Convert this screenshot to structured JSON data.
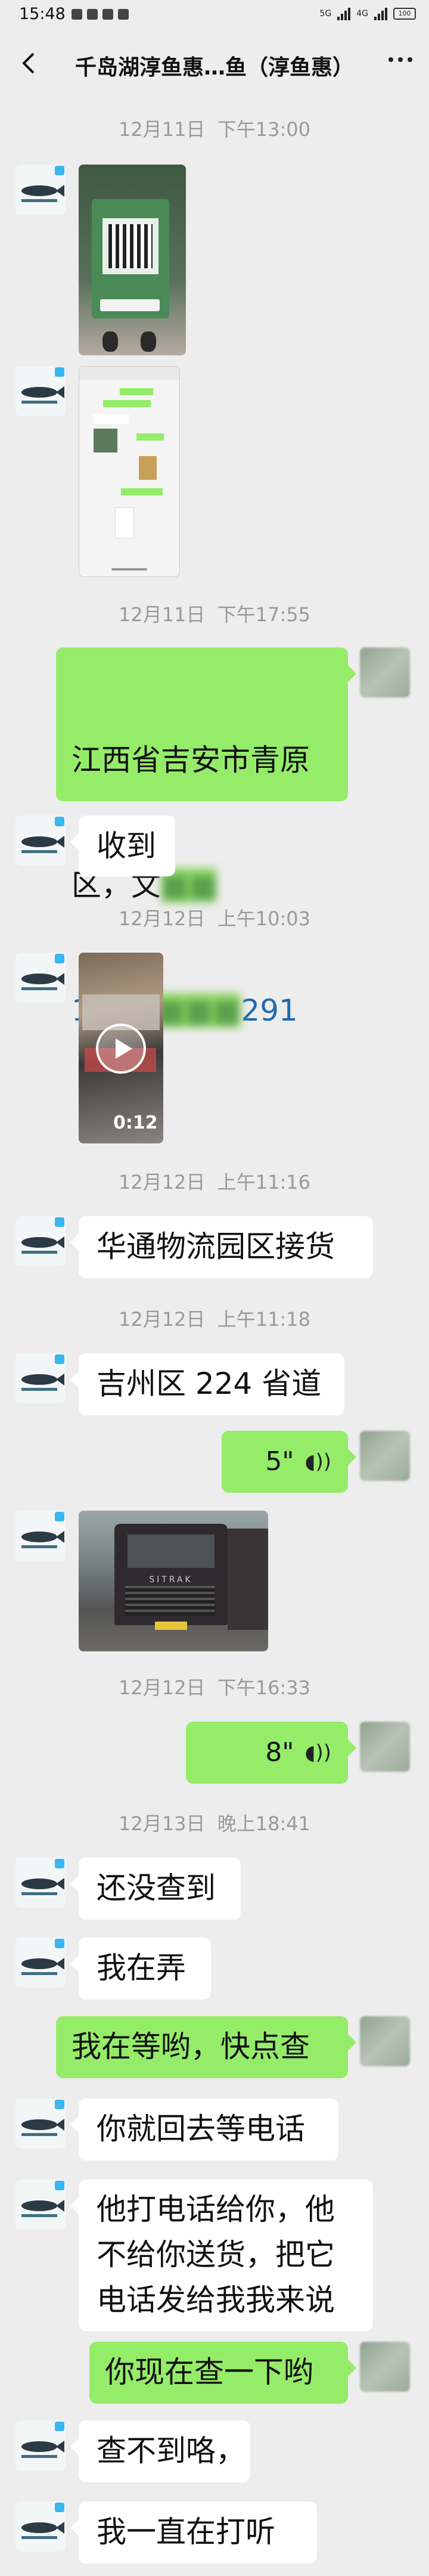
{
  "status_bar": {
    "time": "15:48",
    "network": "5G",
    "signal2": "4G",
    "battery": "100"
  },
  "header": {
    "title": "千岛湖淳鱼惠…鱼（淳鱼惠）"
  },
  "messages": [
    {
      "type": "time",
      "text": "12月11日  下午13:00"
    },
    {
      "type": "image",
      "side": "left",
      "desc": "二维码支付照片"
    },
    {
      "type": "image",
      "side": "left",
      "desc": "聊天截图"
    },
    {
      "type": "time",
      "text": "12月11日  下午17:55"
    },
    {
      "type": "text",
      "side": "right",
      "line1": "江西省吉安市青原",
      "line2_a": "区，文",
      "line2_b": "■■",
      "line3_a": "139",
      "line3_b": "■■■■",
      "line3_c": "291"
    },
    {
      "type": "text",
      "side": "left",
      "text": "收到"
    },
    {
      "type": "time",
      "text": "12月12日  上午10:03"
    },
    {
      "type": "video",
      "side": "left",
      "duration": "0:12"
    },
    {
      "type": "time",
      "text": "12月12日  上午11:16"
    },
    {
      "type": "text",
      "side": "left",
      "text": "华通物流园区接货"
    },
    {
      "type": "time",
      "text": "12月12日  上午11:18"
    },
    {
      "type": "text",
      "side": "left",
      "text": "吉州区 224 省道"
    },
    {
      "type": "voice",
      "side": "right",
      "duration": "5\""
    },
    {
      "type": "image",
      "side": "left",
      "desc": "货车照片",
      "truck_brand": "SITRAK"
    },
    {
      "type": "time",
      "text": "12月12日  下午16:33"
    },
    {
      "type": "voice",
      "side": "right",
      "duration": "8\""
    },
    {
      "type": "time",
      "text": "12月13日  晚上18:41"
    },
    {
      "type": "text",
      "side": "left",
      "text": "还没查到"
    },
    {
      "type": "text",
      "side": "left",
      "text": "我在弄"
    },
    {
      "type": "text",
      "side": "right",
      "text": "我在等哟，快点查"
    },
    {
      "type": "text",
      "side": "left",
      "text": "你就回去等电话"
    },
    {
      "type": "text",
      "side": "left",
      "text": "他打电话给你，他\n不给你送货，把它\n电话发给我我来说"
    },
    {
      "type": "text",
      "side": "right",
      "text": "你现在查一下哟"
    },
    {
      "type": "text",
      "side": "left",
      "text": "查不到咯，"
    },
    {
      "type": "text",
      "side": "left",
      "text": "我一直在打听"
    }
  ],
  "colors": {
    "background": "#ededed",
    "self_bubble": "#95ec69",
    "other_bubble": "#ffffff",
    "timestamp": "#9a9a9a"
  }
}
